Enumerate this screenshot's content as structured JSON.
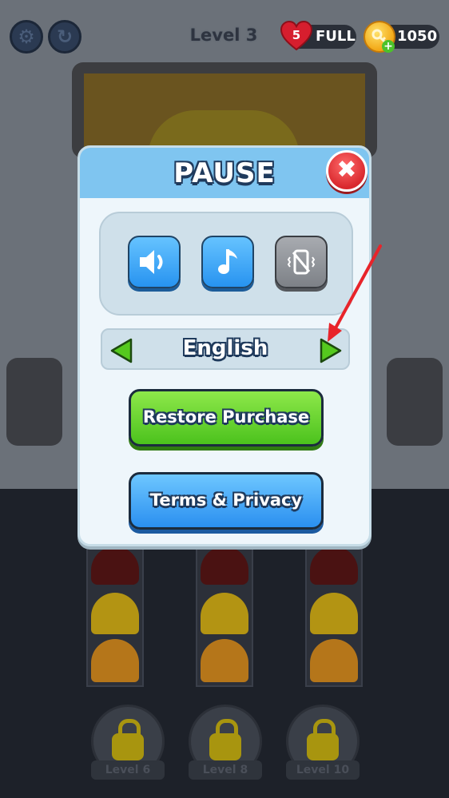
{
  "hud": {
    "level_title": "Level 3",
    "lives_count": "5",
    "lives_status": "FULL",
    "coins": "1050"
  },
  "icons": {
    "settings": "gear-icon",
    "restart": "restart-icon",
    "lives": "heart-icon",
    "coins": "coin-icon",
    "close": "close-icon",
    "sound": "speaker-icon",
    "music": "music-note-icon",
    "vibration": "vibration-off-icon",
    "prev_language": "arrow-left-icon",
    "next_language": "arrow-right-icon",
    "lock": "lock-icon"
  },
  "pause_modal": {
    "title": "PAUSE",
    "language": "English",
    "restore_label": "Restore Purchase",
    "terms_label": "Terms & Privacy"
  },
  "locked_levels": [
    {
      "label": "Level 6"
    },
    {
      "label": "Level 8"
    },
    {
      "label": "Level 10"
    }
  ],
  "colors": {
    "header": "#7fc5f0",
    "green_button": "#4cc21d",
    "blue_button": "#2a8ff0",
    "close_button": "#d9282d",
    "annotation_arrow": "#e8242a"
  }
}
